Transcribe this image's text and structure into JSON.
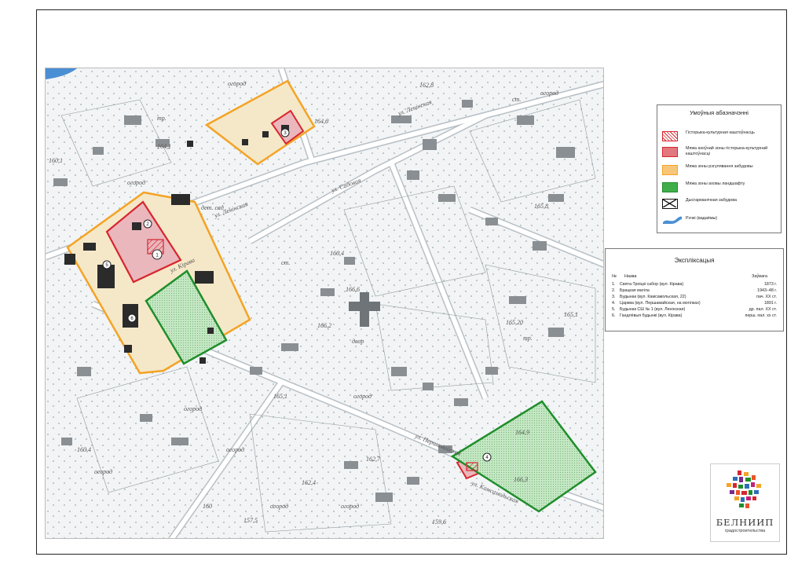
{
  "map": {
    "street_labels": [
      "ул. Ленінская",
      "ул. Садовая",
      "ул. Камсамольская",
      "ул. Кірава",
      "ул. Першамайская",
      "ул. Ленінская"
    ],
    "place_labels": [
      "огород",
      "огород",
      "огород",
      "огород",
      "огород",
      "огород",
      "огород",
      "огород",
      "огород",
      "дет. сад",
      "двор",
      "ст.",
      "тр.",
      "тр.",
      "ст."
    ],
    "elevation_labels": [
      "162,8",
      "164,6",
      "164,1",
      "160,1",
      "165,8",
      "166,4",
      "166,6",
      "166,2",
      "165,20",
      "165,1",
      "165,1",
      "160,4",
      "162,4",
      "157,5",
      "160",
      "164,9",
      "166,3",
      "162,7",
      "159,6"
    ],
    "monument_markers": [
      "1",
      "2",
      "3",
      "4",
      "5",
      "6"
    ],
    "colors": {
      "heritage_boundary": "#d7262e",
      "protection_zone": "#d7262e",
      "regulation_zone": "#f4a326",
      "landscape_zone": "#1f8e2c",
      "river": "#4a8fd4"
    }
  },
  "legend": {
    "title": "Умоўныя абазначэнні",
    "items": [
      {
        "label": "Гісторыка-культурная каштоўнасць",
        "kind": "heritage"
      },
      {
        "label": "Мяжа ахоўнай зоны гісторыка-культурнай каштоўнасці",
        "kind": "protection"
      },
      {
        "label": "Мяжа зоны рэгулявання забудовы",
        "kind": "regulation"
      },
      {
        "label": "Мяжа зоны аховы ландшафту",
        "kind": "landscape"
      },
      {
        "label": "Дысгарманічная забудова",
        "kind": "disharmonic"
      },
      {
        "label": "Рэчкі (вадаёмы)",
        "kind": "river"
      }
    ]
  },
  "explication": {
    "title": "Экспліксацыя",
    "col_no": "№",
    "col_name": "Назва",
    "col_note": "Заўвага",
    "rows": [
      {
        "no": "1.",
        "name": "Свята-Троіцкі сабор (вул. Кірава)",
        "note": "1873 г."
      },
      {
        "no": "2.",
        "name": "Брацкая магіла",
        "note": "1943–48 г."
      },
      {
        "no": "3.",
        "name": "Будынак (вул. Камсамольская, 22)",
        "note": "пач. ХХ ст."
      },
      {
        "no": "4.",
        "name": "Царква (вул. Першамайская, на могілках)",
        "note": "1891 г."
      },
      {
        "no": "5.",
        "name": "Будынак СШ № 1 (вул. Ленінская)",
        "note": "др. пал. ХХ ст."
      },
      {
        "no": "6.",
        "name": "Гандлёвыя будынкі (вул. Кірава)",
        "note": "перш. пал. хх ст."
      }
    ]
  },
  "logo": {
    "name": "БЕЛНИИП",
    "subtitle": "градостроительства"
  }
}
